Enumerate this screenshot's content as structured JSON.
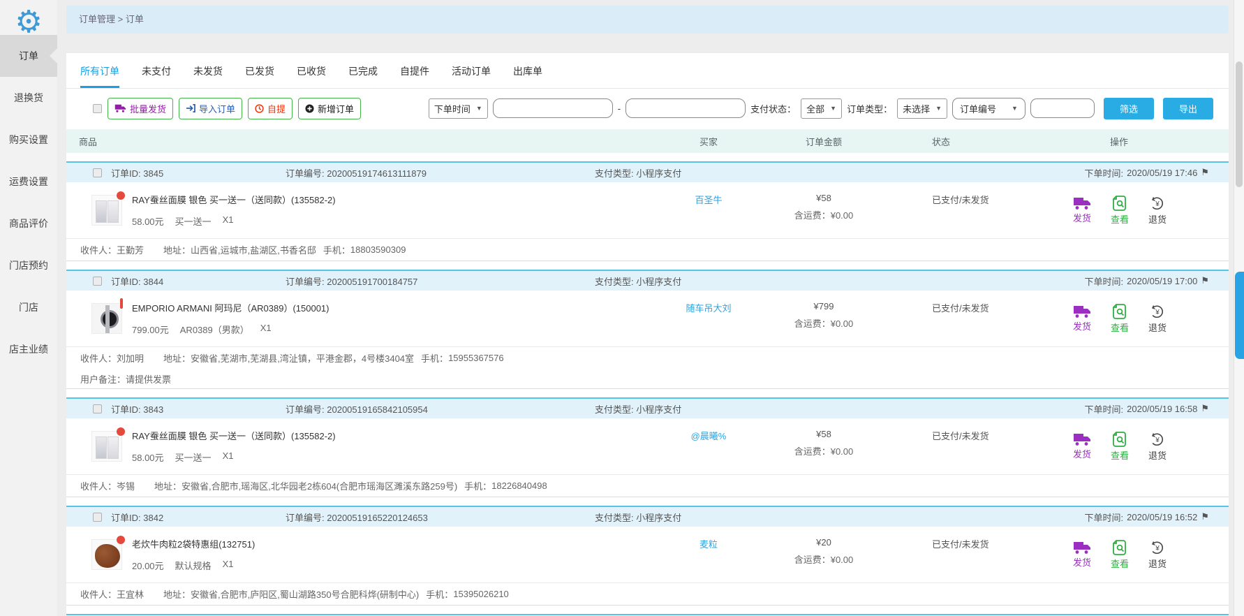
{
  "colors": {
    "accent_blue": "#29abe3",
    "tab_active": "#1a9fe0",
    "green_border": "#44b549",
    "order_header_bg": "#e2f2fb",
    "order_header_border": "#55c4e9",
    "table_header_bg": "#e8f6f3",
    "breadcrumb_bg": "#d9ecf7",
    "badge_red": "#e5493d",
    "purple": "#9b2fc1",
    "green": "#2fae43"
  },
  "sidebar": {
    "logo_icon": "gear-icon",
    "items": [
      {
        "label": "订单",
        "active": true
      },
      {
        "label": "退换货"
      },
      {
        "label": "购买设置"
      },
      {
        "label": "运费设置"
      },
      {
        "label": "商品评价"
      },
      {
        "label": "门店预约"
      },
      {
        "label": "门店"
      },
      {
        "label": "店主业绩"
      }
    ]
  },
  "breadcrumb": "订单管理 > 订单",
  "tabs": [
    {
      "label": "所有订单",
      "active": true
    },
    {
      "label": "未支付"
    },
    {
      "label": "未发货"
    },
    {
      "label": "已发货"
    },
    {
      "label": "已收货"
    },
    {
      "label": "已完成"
    },
    {
      "label": "自提件"
    },
    {
      "label": "活动订单"
    },
    {
      "label": "出库单"
    }
  ],
  "toolbar": {
    "batch_ship": "批量发货",
    "import_order": "导入订单",
    "self_pickup": "自提",
    "new_order": "新增订单",
    "filters": {
      "time_select": "下单时间",
      "date_from": "",
      "date_to": "",
      "range_separator": "-",
      "pay_status_label": "支付状态：",
      "pay_status_select": "全部",
      "order_type_label": "订单类型：",
      "order_type_select": "未选择",
      "search_select": "订单编号",
      "search_value": "",
      "filter_btn": "筛选",
      "export_btn": "导出"
    }
  },
  "table": {
    "headers": [
      "商品",
      "买家",
      "订单金额",
      "状态",
      "操作"
    ]
  },
  "labels": {
    "order_id": "订单ID:",
    "order_no": "订单编号:",
    "pay_type": "支付类型:",
    "order_time": "下单时间:",
    "receiver": "收件人：",
    "address": "地址：",
    "phone": "手机：",
    "remark": "用户备注："
  },
  "actions": {
    "ship": "发货",
    "view": "查看",
    "refund": "退货"
  },
  "orders": [
    {
      "id": "3845",
      "no": "20200519174613111879",
      "pay_type": "小程序支付",
      "time": "2020/05/19 17:46",
      "product": {
        "name": "RAY蚕丝面膜 银色 买一送一（送同款）(135582-2)",
        "price": "58.00元",
        "spec": "买一送一",
        "qty": "X1"
      },
      "buyer": "百圣牛",
      "amount": "¥58",
      "shipping": "含运费：¥0.00",
      "status": "已支付/未发货",
      "receiver": {
        "name": "王勤芳",
        "address": "山西省,运城市,盐湖区,书香名邸",
        "phone": "18803590309"
      }
    },
    {
      "id": "3844",
      "no": "202005191700184757",
      "pay_type": "小程序支付",
      "time": "2020/05/19 17:00",
      "product": {
        "name": "EMPORIO ARMANI 阿玛尼（AR0389）(150001)",
        "price": "799.00元",
        "spec": "AR0389（男款）",
        "qty": "X1"
      },
      "buyer": "随车吊大刘",
      "amount": "¥799",
      "shipping": "含运费：¥0.00",
      "status": "已支付/未发货",
      "receiver": {
        "name": "刘加明",
        "address": "安徽省,芜湖市,芜湖县,湾沚镇，平港金郡，4号楼3404室",
        "phone": "15955367576"
      },
      "remark": "请提供发票"
    },
    {
      "id": "3843",
      "no": "20200519165842105954",
      "pay_type": "小程序支付",
      "time": "2020/05/19 16:58",
      "product": {
        "name": "RAY蚕丝面膜 银色 买一送一（送同款）(135582-2)",
        "price": "58.00元",
        "spec": "买一送一",
        "qty": "X1"
      },
      "buyer": "@晨曦%",
      "amount": "¥58",
      "shipping": "含运费：¥0.00",
      "status": "已支付/未发货",
      "receiver": {
        "name": "岑锡",
        "address": "安徽省,合肥市,瑶海区,北华园老2栋604(合肥市瑶海区濉溪东路259号)",
        "phone": "18226840498"
      }
    },
    {
      "id": "3842",
      "no": "20200519165220124653",
      "pay_type": "小程序支付",
      "time": "2020/05/19 16:52",
      "product": {
        "name": "老炊牛肉粒2袋特惠组(132751)",
        "price": "20.00元",
        "spec": "默认规格",
        "qty": "X1"
      },
      "buyer": "麦粒",
      "amount": "¥20",
      "shipping": "含运费：¥0.00",
      "status": "已支付/未发货",
      "receiver": {
        "name": "王宜林",
        "address": "安徽省,合肥市,庐阳区,蜀山湖路350号合肥科烨(研制中心)",
        "phone": "15395026210"
      }
    }
  ]
}
